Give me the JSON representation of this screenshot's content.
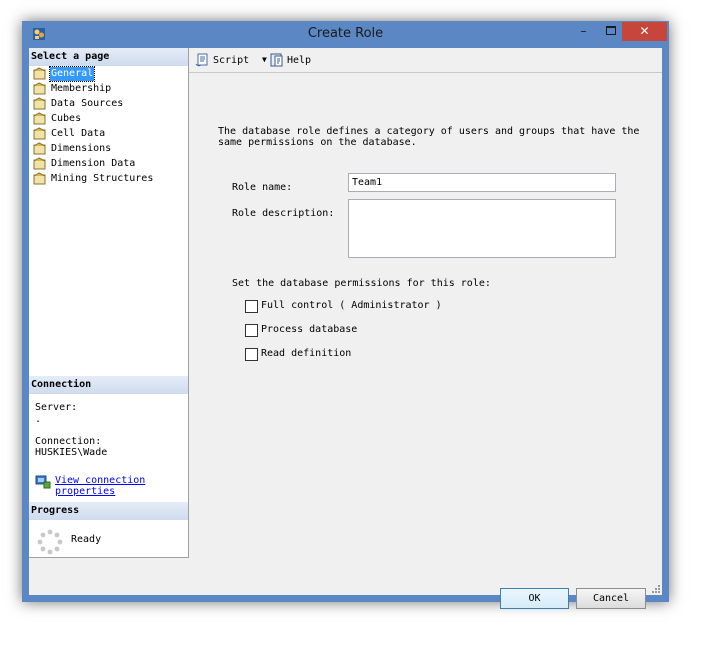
{
  "window": {
    "title": "Create Role",
    "minimize_label": "–",
    "close_label": "✕"
  },
  "sidebar": {
    "select_page_header": "Select a page",
    "pages": [
      {
        "label": "General"
      },
      {
        "label": "Membership"
      },
      {
        "label": "Data Sources"
      },
      {
        "label": "Cubes"
      },
      {
        "label": "Cell Data"
      },
      {
        "label": "Dimensions"
      },
      {
        "label": "Dimension Data"
      },
      {
        "label": "Mining Structures"
      }
    ],
    "selected_index": 0,
    "connection_header": "Connection",
    "server_label": "Server:",
    "server_value": ".",
    "connection_label": "Connection:",
    "connection_value": "HUSKIES\\Wade",
    "view_connection_link": "View connection properties",
    "progress_header": "Progress",
    "progress_status": "Ready"
  },
  "toolbar": {
    "script_label": "Script",
    "help_label": "Help",
    "dropdown_arrow": "▼"
  },
  "form": {
    "description": "The database role defines a category of users and groups that have the same permissions on the database.",
    "role_name_label": "Role name:",
    "role_name_value": "Team1",
    "role_description_label": "Role description:",
    "role_description_value": "",
    "permissions_heading": "Set the database permissions for this role:",
    "permissions": [
      {
        "label": "Full control ( Administrator )",
        "checked": false
      },
      {
        "label": "Process database",
        "checked": false
      },
      {
        "label": "Read definition",
        "checked": false
      }
    ]
  },
  "footer": {
    "ok_label": "OK",
    "cancel_label": "Cancel"
  },
  "colors": {
    "window_frame": "#5b87c5",
    "close_button": "#c7463c",
    "selection": "#3399ff",
    "link": "#0000ff"
  }
}
